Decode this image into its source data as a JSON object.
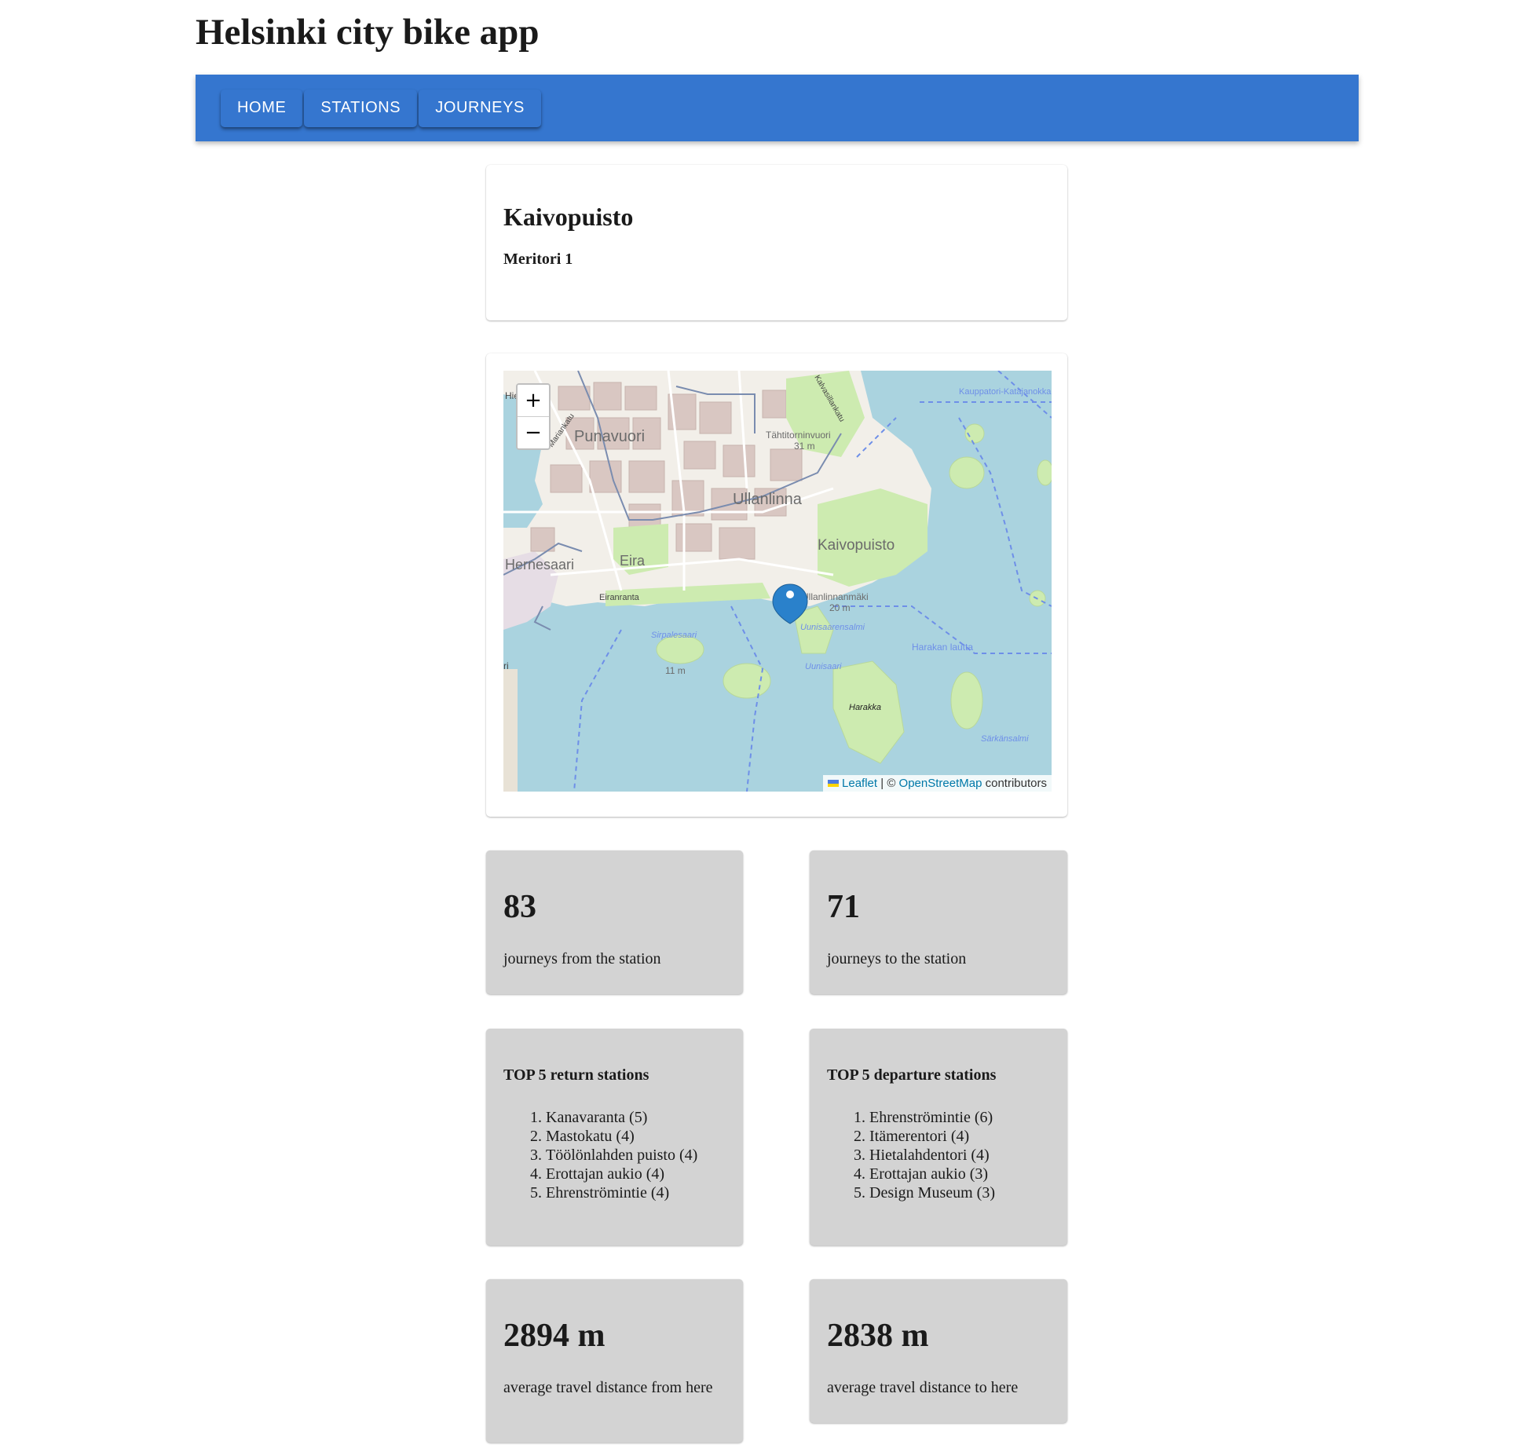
{
  "app": {
    "title": "Helsinki city bike app"
  },
  "nav": {
    "items": [
      "HOME",
      "STATIONS",
      "JOURNEYS"
    ]
  },
  "station": {
    "name": "Kaivopuisto",
    "address": "Meritori 1"
  },
  "map": {
    "zoom_in": "+",
    "zoom_out": "−",
    "place_labels": [
      "Punavuori",
      "Ullanlinna",
      "Kaivopuisto",
      "Eira",
      "Hernesaari",
      "Tähtitorninvuori",
      "31 m",
      "Ullanlinnanmäki",
      "20 m",
      "Uunisaarensalmi",
      "Sirpalesaari",
      "Uunisaari",
      "Harakka",
      "Harakan lautta",
      "Kauppatori-Katajanokka",
      "Särkänsalmi",
      "Eiranranta",
      "Mariankatu",
      "Kalvasillankatu",
      "11 m",
      "Hie",
      "ri"
    ],
    "attribution": {
      "leaflet": "Leaflet",
      "separator": "| ©",
      "osm": "OpenStreetMap",
      "contributors": "contributors"
    },
    "colors": {
      "water": "#aad3df",
      "land": "#f2efe9",
      "park": "#cdebb0",
      "building": "#d9d0c9",
      "marker": "#2a81cb"
    }
  },
  "stats": {
    "journeys_from": {
      "value": "83",
      "label": "journeys from the station"
    },
    "journeys_to": {
      "value": "71",
      "label": "journeys to the station"
    },
    "avg_from": {
      "value": "2894 m",
      "label": "average travel distance from here"
    },
    "avg_to": {
      "value": "2838 m",
      "label": "average travel distance to here"
    }
  },
  "top_return": {
    "title": "TOP 5 return stations",
    "items": [
      "Kanavaranta (5)",
      "Mastokatu (4)",
      "Töölönlahden puisto (4)",
      "Erottajan aukio (4)",
      "Ehrenströmintie (4)"
    ]
  },
  "top_departure": {
    "title": "TOP 5 departure stations",
    "items": [
      "Ehrenströmintie (6)",
      "Itämerentori (4)",
      "Hietalahdentori (4)",
      "Erottajan aukio (3)",
      "Design Museum (3)"
    ]
  }
}
